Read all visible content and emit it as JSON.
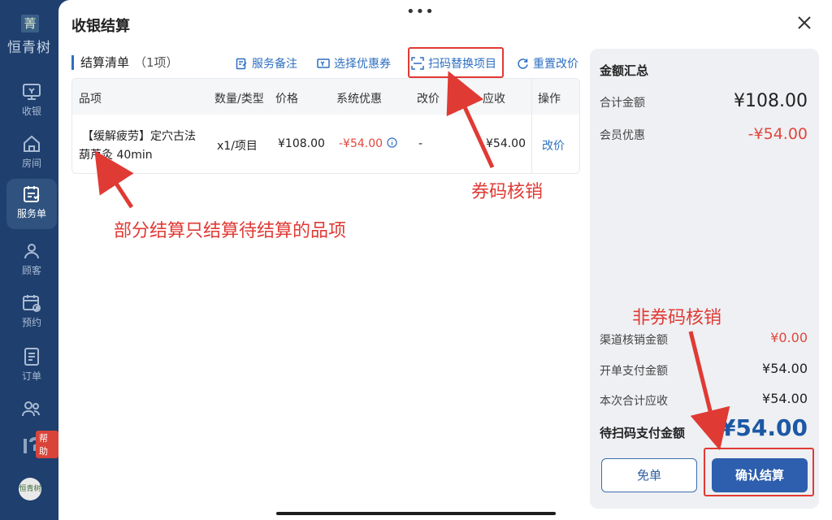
{
  "sidebar": {
    "brand_mark": "菁",
    "brand_name": "恒青树",
    "items": [
      {
        "label": "收银",
        "icon": "cashier-icon"
      },
      {
        "label": "房间",
        "icon": "home-icon"
      },
      {
        "label": "服务单",
        "icon": "service-order-icon"
      },
      {
        "label": "顾客",
        "icon": "customer-icon"
      },
      {
        "label": "预约",
        "icon": "calendar-icon"
      },
      {
        "label": "订单",
        "icon": "order-icon"
      },
      {
        "label": "",
        "icon": "staff-icon"
      }
    ],
    "active_item": "服务单",
    "help_badge": "帮助",
    "bottom_logo": "恒青树"
  },
  "panel": {
    "drag_handle": "•••",
    "title": "收银结算",
    "close_icon": "close-icon"
  },
  "list": {
    "title": "结算清单",
    "count": "（1项）",
    "tools": {
      "service_note": "服务备注",
      "select_coupon": "选择优惠券",
      "scan_replace": "扫码替换项目",
      "reset_price": "重置改价"
    },
    "columns": [
      "品项",
      "数量/类型",
      "价格",
      "系统优惠",
      "改价",
      "应收",
      "操作"
    ],
    "rows": [
      {
        "item_line1": "【缓解疲劳】定穴古法",
        "item_line2": "葫芦灸 40min",
        "qty_type": "x1/项目",
        "price": "¥108.00",
        "discount": "-¥54.00",
        "modified_price": "-",
        "receivable": "¥54.00",
        "action": "改价"
      }
    ]
  },
  "summary": {
    "title": "金额汇总",
    "total_label": "合计金额",
    "total_value": "¥108.00",
    "member_label": "会员优惠",
    "member_value": "-¥54.00",
    "channel_label": "渠道核销金额",
    "channel_value": "¥0.00",
    "opened_label": "开单支付金额",
    "opened_value": "¥54.00",
    "current_label": "本次合计应收",
    "current_value": "¥54.00",
    "due_label": "待扫码支付金额",
    "due_value": "¥54.00",
    "free_button": "免单",
    "confirm_button": "确认结算"
  },
  "annotations": {
    "coupon_verify": "券码核销",
    "partial_settle": "部分结算只结算待结算的品项",
    "non_coupon_verify": "非券码核销"
  },
  "colors": {
    "sidebar_bg": "#1f3f6e",
    "accent_blue": "#2d6fc0",
    "discount_red": "#e0473d",
    "annotation_red": "#e03a35",
    "confirm_bg": "#2d5fae"
  }
}
